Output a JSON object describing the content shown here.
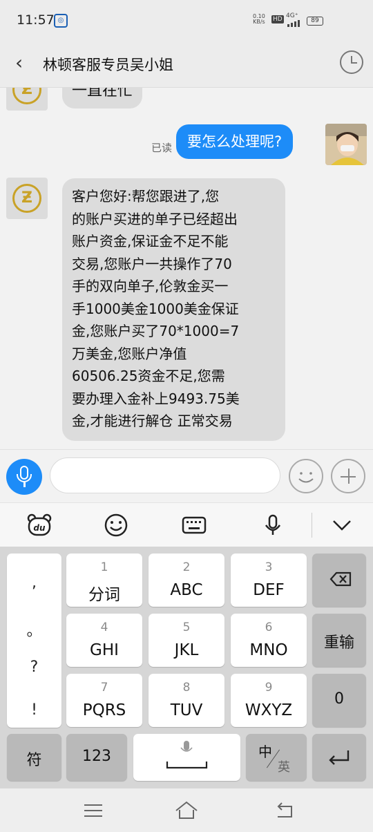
{
  "status_bar": {
    "time": "11:57",
    "app_notification_icon": "app-notification-icon",
    "net_speed_top": "0.10",
    "net_speed_bottom": "KB/s",
    "hd_label": "HD",
    "network_type": "4G⁺",
    "battery_level": "89"
  },
  "header": {
    "back_icon": "‹",
    "title": "林顿客服专员吴小姐",
    "history_icon": "clock-icon"
  },
  "messages": [
    {
      "side": "left",
      "text": "一直在忙"
    },
    {
      "side": "right",
      "text": "要怎么处理呢?",
      "status": "已读"
    },
    {
      "side": "left",
      "lines": [
        "客户您好:帮您跟进了,您",
        "的账户买进的单子已经超出",
        "账户资金,保证金不足不能",
        "交易,您账户一共操作了70",
        "手的双向单子,伦敦金买一",
        "手1000美金1000美金保证",
        "金,您账户买了70*1000=7",
        "万美金,您账户净值",
        "60506.25资金不足,您需",
        "要办理入金补上9493.75美",
        "金,才能进行解仓 正常交易"
      ]
    }
  ],
  "input_bar": {
    "placeholder": "",
    "voice_icon": "microphone-icon",
    "emoji_icon": "smile-icon",
    "more_icon": "plus-icon"
  },
  "keyboard_toolbar": {
    "items": [
      "du-logo-icon",
      "emoji-icon",
      "keyboard-icon",
      "voice-input-icon",
      "collapse-chevron-icon"
    ]
  },
  "keyboard": {
    "punctuation": [
      ",",
      "。",
      "?",
      "!"
    ],
    "rows": [
      [
        {
          "num": "1",
          "label": "分词"
        },
        {
          "num": "2",
          "label": "ABC"
        },
        {
          "num": "3",
          "label": "DEF"
        }
      ],
      [
        {
          "num": "4",
          "label": "GHI"
        },
        {
          "num": "5",
          "label": "JKL"
        },
        {
          "num": "6",
          "label": "MNO"
        }
      ],
      [
        {
          "num": "7",
          "label": "PQRS"
        },
        {
          "num": "8",
          "label": "TUV"
        },
        {
          "num": "9",
          "label": "WXYZ"
        }
      ]
    ],
    "delete_icon": "backspace-icon",
    "retype_label": "重输",
    "zero_label": "0",
    "symbols_label": "符",
    "numbers_label": "123",
    "lang_top": "中",
    "lang_bottom": "英",
    "enter_icon": "enter-icon"
  },
  "nav_bar": {
    "items": [
      "menu-icon",
      "home-icon",
      "back-icon"
    ]
  }
}
